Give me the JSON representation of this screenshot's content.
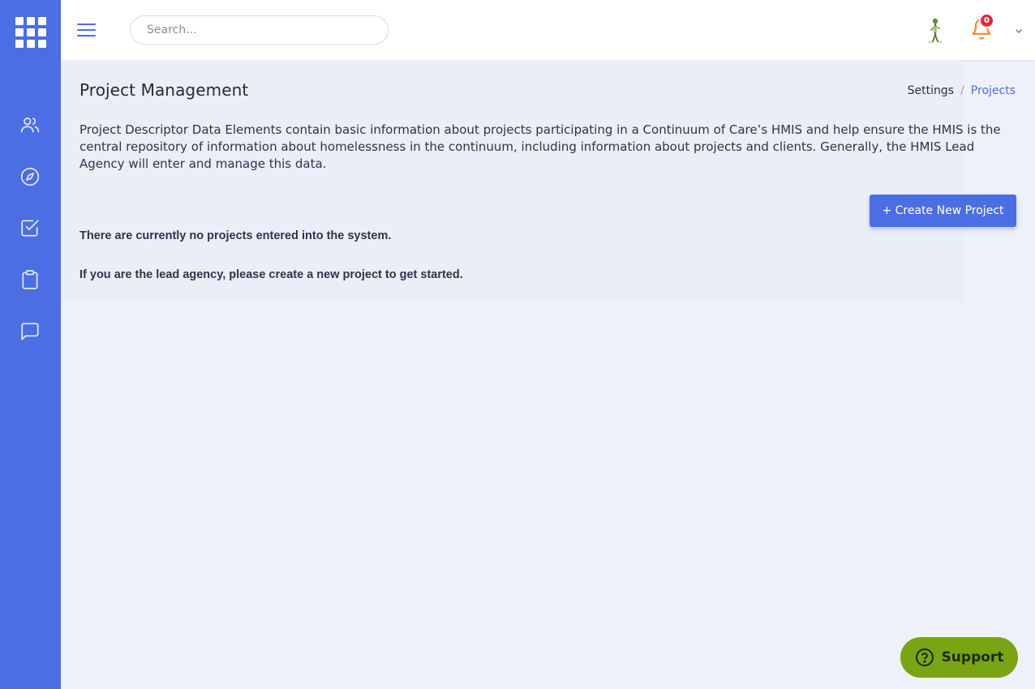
{
  "search": {
    "placeholder": "Search..."
  },
  "notifications": {
    "count": "0"
  },
  "page": {
    "title": "Project Management"
  },
  "breadcrumb": {
    "items": [
      "Settings",
      "Projects"
    ],
    "separator": "/"
  },
  "description": "Project Descriptor Data Elements contain basic information about projects participating in a Continuum of Care’s HMIS and help ensure the HMIS is the central repository of information about homelessness in the continuum, including information about projects and clients. Generally, the HMIS Lead Agency will enter and manage this data.",
  "actions": {
    "create_label": "+ Create New Project"
  },
  "messages": {
    "none": "There are currently no projects entered into the system.",
    "hint": "If you are the lead agency, please create a new project to get started."
  },
  "support": {
    "label": "Support"
  },
  "sidebar": {
    "icons": [
      "users-icon",
      "compass-icon",
      "checkbox-icon",
      "clipboard-icon",
      "message-icon"
    ]
  },
  "colors": {
    "sidebar": "#4c6ee3",
    "accent": "#4c6ee3",
    "support": "#79a514",
    "badge": "#e2293a",
    "bell": "#f28c28"
  }
}
